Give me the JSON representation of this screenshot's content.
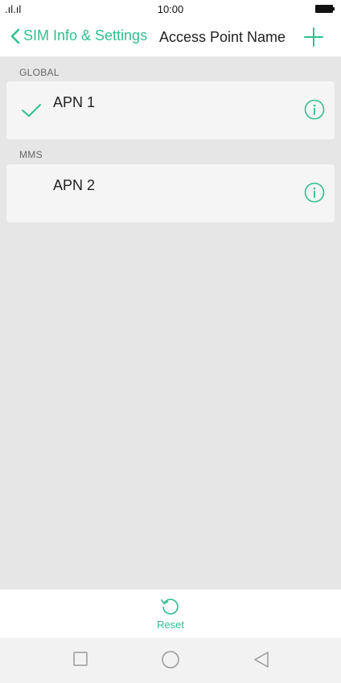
{
  "status_bar": {
    "signal": ".ıl.ıl",
    "time": "10:00"
  },
  "header": {
    "back_label": "SIM Info & Settings",
    "title": "Access Point Name"
  },
  "sections": [
    {
      "header": "GLOBAL",
      "item": {
        "label": "APN 1",
        "selected": true
      }
    },
    {
      "header": "MMS",
      "item": {
        "label": "APN 2",
        "selected": false
      }
    }
  ],
  "bottom_action": {
    "label": "Reset"
  },
  "colors": {
    "accent": "#2fbf8f",
    "background": "#e6e6e6",
    "card": "#f5f5f5"
  },
  "icons": [
    "back-chevron-icon",
    "add-icon",
    "check-icon",
    "info-icon",
    "reset-icon",
    "nav-square-icon",
    "nav-circle-icon",
    "nav-back-icon"
  ]
}
